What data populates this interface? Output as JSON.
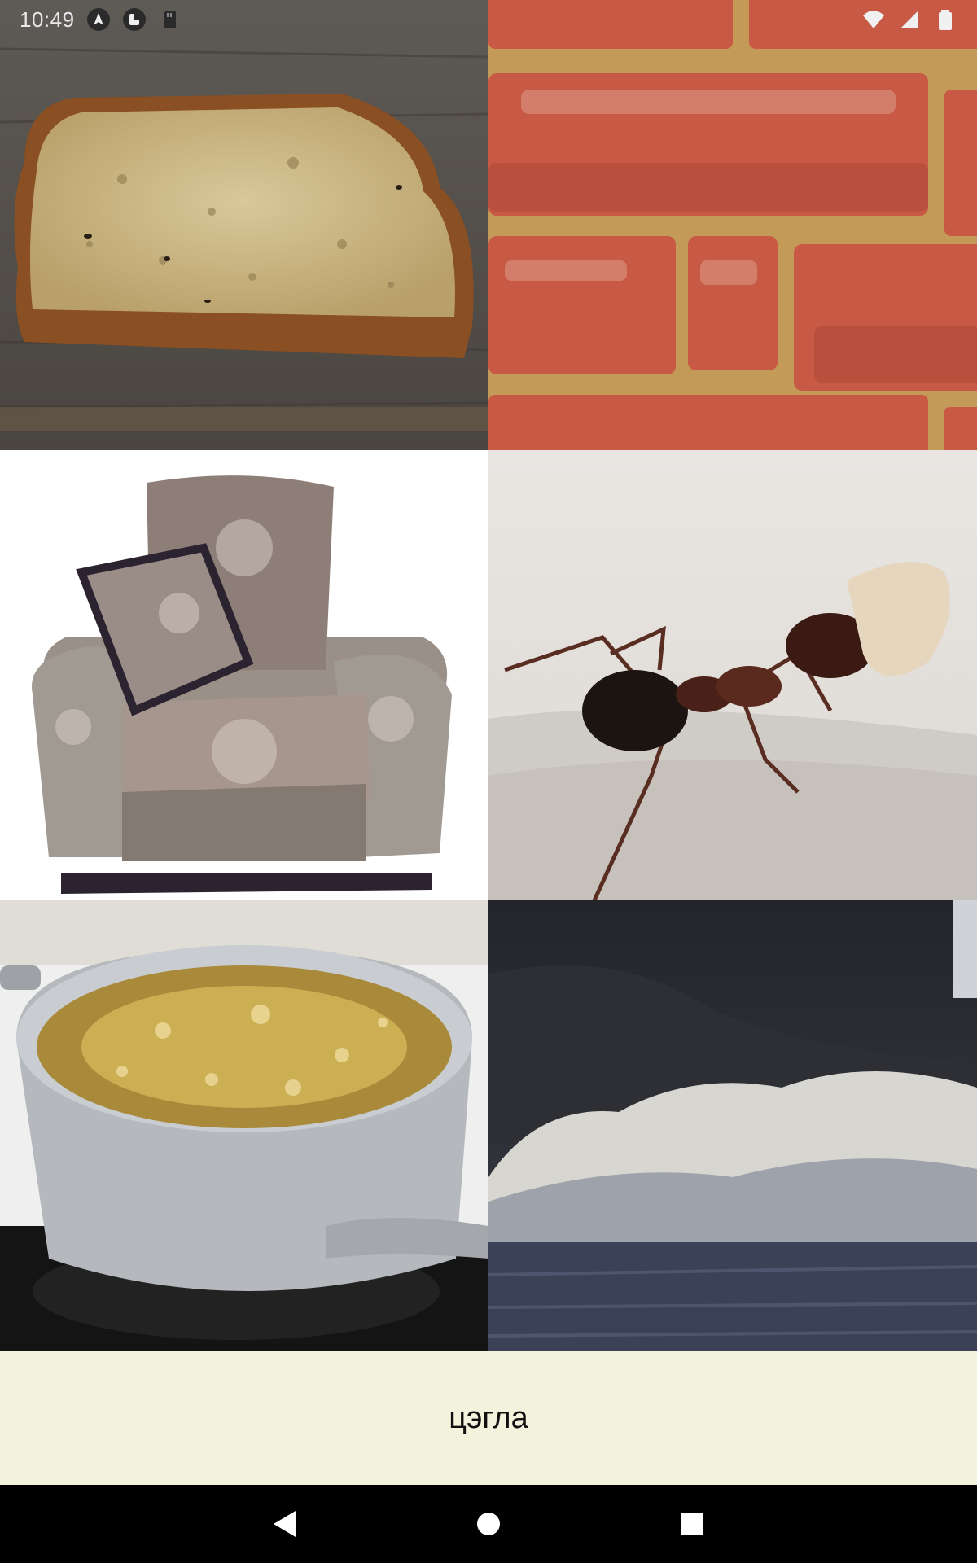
{
  "status_bar": {
    "time": "10:49",
    "left_icons": [
      "navigation-arrow-icon",
      "app-notification-icon",
      "sd-card-icon"
    ],
    "right_icons": [
      "wifi-icon",
      "cellular-signal-icon",
      "battery-icon"
    ]
  },
  "tiles": [
    {
      "name": "tile-bread",
      "subject": "bread-slice-image"
    },
    {
      "name": "tile-brick",
      "subject": "brick-wall-image"
    },
    {
      "name": "tile-armchair",
      "subject": "armchair-image"
    },
    {
      "name": "tile-ant",
      "subject": "ant-image"
    },
    {
      "name": "tile-pot",
      "subject": "boiling-pot-image"
    },
    {
      "name": "tile-wave",
      "subject": "ocean-wave-image"
    }
  ],
  "answer": {
    "word": "цэгла"
  },
  "nav_bar": {
    "buttons": [
      "back-icon",
      "home-icon",
      "recents-icon"
    ]
  },
  "colors": {
    "answer_background": "#f3f2dc",
    "nav_background": "#000000"
  }
}
